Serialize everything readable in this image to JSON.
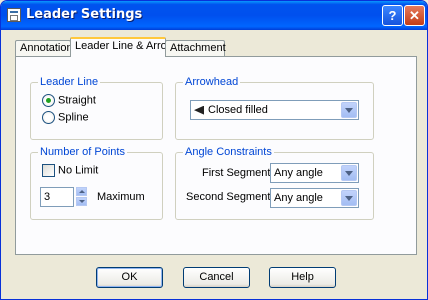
{
  "window": {
    "title": "Leader Settings",
    "help_label": "?",
    "close_label": "✕"
  },
  "tabs": [
    {
      "label": "Annotation",
      "active": false
    },
    {
      "label": "Leader Line & Arrow",
      "active": true
    },
    {
      "label": "Attachment",
      "active": false
    }
  ],
  "leader_line": {
    "title": "Leader Line",
    "options": [
      {
        "label": "Straight",
        "checked": true
      },
      {
        "label": "Spline",
        "checked": false
      }
    ]
  },
  "arrowhead": {
    "title": "Arrowhead",
    "selected": "Closed filled",
    "icon": "closed-filled-arrow-icon"
  },
  "number_of_points": {
    "title": "Number of Points",
    "no_limit_label": "No Limit",
    "no_limit_checked": false,
    "value": "3",
    "maximum_label": "Maximum"
  },
  "angle_constraints": {
    "title": "Angle Constraints",
    "first_label": "First Segment:",
    "first_value": "Any angle",
    "second_label": "Second Segment:",
    "second_value": "Any angle"
  },
  "buttons": {
    "ok": "OK",
    "cancel": "Cancel",
    "help": "Help"
  },
  "colors": {
    "titlebar": "#0053ee",
    "group_title": "#0046d5",
    "dialog_bg": "#ece9d8"
  }
}
